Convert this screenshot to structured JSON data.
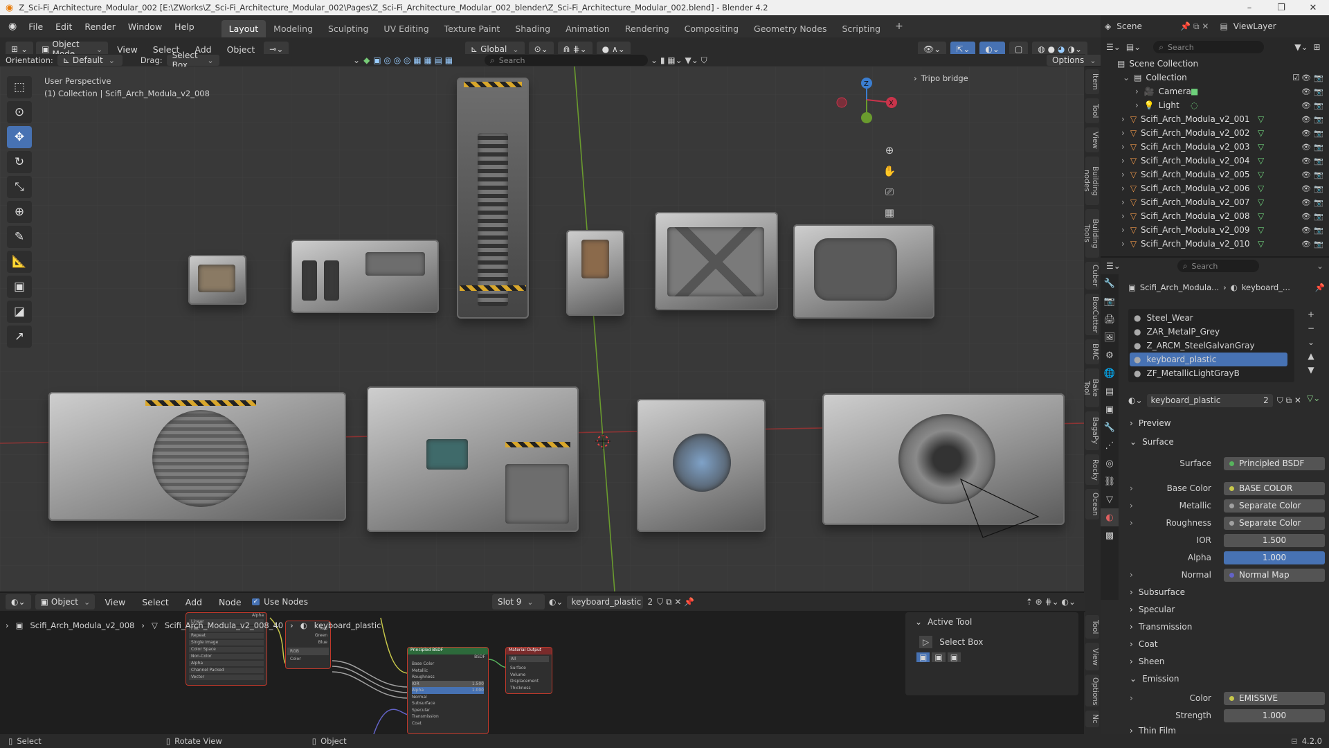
{
  "titlebar": {
    "title": "Z_Sci-Fi_Architecture_Modular_002 [E:\\ZWorks\\Z_Sci-Fi_Architecture_Modular_002\\Pages\\Z_Sci-Fi_Architecture_Modular_002_blender\\Z_Sci-Fi_Architecture_Modular_002.blend] - Blender 4.2",
    "minimize": "–",
    "maximize": "❐",
    "close": "✕"
  },
  "menu": [
    "File",
    "Edit",
    "Render",
    "Window",
    "Help"
  ],
  "workspaces": [
    {
      "label": "Layout",
      "active": true
    },
    {
      "label": "Modeling"
    },
    {
      "label": "Sculpting"
    },
    {
      "label": "UV Editing"
    },
    {
      "label": "Texture Paint"
    },
    {
      "label": "Shading"
    },
    {
      "label": "Animation"
    },
    {
      "label": "Rendering"
    },
    {
      "label": "Compositing"
    },
    {
      "label": "Geometry Nodes"
    },
    {
      "label": "Scripting"
    }
  ],
  "add_workspace": "+",
  "scene": {
    "label": "Scene",
    "viewlayer": "ViewLayer"
  },
  "viewport_header": {
    "mode": "Object Mode",
    "menus": [
      "View",
      "Select",
      "Add",
      "Object"
    ],
    "transform": "Global",
    "orientation_label": "Orientation:",
    "orientation": "Default",
    "drag_label": "Drag:",
    "drag": "Select Box",
    "search_placeholder": "Search",
    "options": "Options"
  },
  "viewport": {
    "perspective": "User Perspective",
    "collection_info": "(1) Collection | Scifi_Arch_Modula_v2_008",
    "tripo_bridge": "Tripo bridge",
    "gizmo": {
      "x": "X",
      "y": "Y",
      "z": "Z"
    }
  },
  "side_tabs": [
    "Item",
    "Tool",
    "View",
    "Building nodes",
    "Building Tools",
    "Cuber",
    "BoxCutter",
    "BMC",
    "Bake Tool",
    "BagaPy",
    "Rocky",
    "Ocean"
  ],
  "outliner": {
    "search_placeholder": "Search",
    "scene_collection": "Scene Collection",
    "collection": "Collection",
    "items": [
      {
        "name": "Camera",
        "type": "camera"
      },
      {
        "name": "Light",
        "type": "light"
      },
      {
        "name": "Scifi_Arch_Modula_v2_001",
        "type": "mesh"
      },
      {
        "name": "Scifi_Arch_Modula_v2_002",
        "type": "mesh"
      },
      {
        "name": "Scifi_Arch_Modula_v2_003",
        "type": "mesh"
      },
      {
        "name": "Scifi_Arch_Modula_v2_004",
        "type": "mesh"
      },
      {
        "name": "Scifi_Arch_Modula_v2_005",
        "type": "mesh"
      },
      {
        "name": "Scifi_Arch_Modula_v2_006",
        "type": "mesh"
      },
      {
        "name": "Scifi_Arch_Modula_v2_007",
        "type": "mesh"
      },
      {
        "name": "Scifi_Arch_Modula_v2_008",
        "type": "mesh",
        "selected": true
      },
      {
        "name": "Scifi_Arch_Modula_v2_009",
        "type": "mesh"
      },
      {
        "name": "Scifi_Arch_Modula_v2_010",
        "type": "mesh"
      }
    ]
  },
  "properties": {
    "search_placeholder": "Search",
    "breadcrumb_object": "Scifi_Arch_Modula...",
    "breadcrumb_material": "keyboard_...",
    "material_slots": [
      {
        "name": "Steel_Wear"
      },
      {
        "name": "ZAR_MetalP_Grey"
      },
      {
        "name": "Z_ARCM_SteelGalvanGray"
      },
      {
        "name": "keyboard_plastic",
        "active": true
      },
      {
        "name": "ZF_MetallicLightGrayB"
      }
    ],
    "material_name": "keyboard_plastic",
    "material_users": "2",
    "preview": "Preview",
    "surface_section": "Surface",
    "rows": [
      {
        "label": "Surface",
        "value": "Principled BSDF",
        "kind": "link",
        "color": "#57b35d"
      },
      {
        "label": "Base Color",
        "value": "BASE COLOR",
        "kind": "link",
        "color": "#c7c74a",
        "expand": true
      },
      {
        "label": "Metallic",
        "value": "Separate Color",
        "kind": "link",
        "color": "#a1a1a1",
        "expand": true
      },
      {
        "label": "Roughness",
        "value": "Separate Color",
        "kind": "link",
        "color": "#a1a1a1",
        "expand": true
      },
      {
        "label": "IOR",
        "value": "1.500",
        "kind": "num"
      },
      {
        "label": "Alpha",
        "value": "1.000",
        "kind": "blue"
      },
      {
        "label": "Normal",
        "value": "Normal Map",
        "kind": "link",
        "color": "#6363c7",
        "expand": true
      }
    ],
    "sections": [
      "Subsurface",
      "Specular",
      "Transmission",
      "Coat",
      "Sheen"
    ],
    "emission": "Emission",
    "emission_rows": [
      {
        "label": "Color",
        "value": "EMISSIVE",
        "kind": "link",
        "color": "#c7c74a",
        "expand": true
      },
      {
        "label": "Strength",
        "value": "1.000",
        "kind": "num"
      }
    ],
    "thin_film": "Thin Film"
  },
  "node_editor": {
    "type": "Object",
    "menus": [
      "View",
      "Select",
      "Add",
      "Node"
    ],
    "use_nodes": "Use Nodes",
    "slot": "Slot 9",
    "material": "keyboard_plastic",
    "users": "2",
    "breadcrumb": [
      "Scifi_Arch_Modula_v2_008",
      "Scifi_Arch_Modula_v2_008_40",
      "keyboard_plastic"
    ],
    "active_tool_title": "Active Tool",
    "active_tool_name": "Select Box",
    "side_tabs": [
      "Tool",
      "View",
      "Options",
      "Nc"
    ],
    "nodes": {
      "bsdf_title": "Principled BSDF",
      "bsdf_out": "BSDF",
      "bsdf_inputs": [
        "Base Color",
        "Metallic",
        "Roughness",
        "IOR",
        "Alpha",
        "Normal",
        "Subsurface",
        "Specular",
        "Transmission",
        "Coat"
      ],
      "bsdf_ior": "1.500",
      "bsdf_alpha": "1.000",
      "output_title": "Material Output",
      "output_target": "All",
      "output_inputs": [
        "Surface",
        "Volume",
        "Displacement",
        "Thickness"
      ],
      "tex_outputs": [
        "Alpha"
      ],
      "tex_rows": [
        "Linear",
        "Flat",
        "Repeat",
        "Single Image",
        "Color Space",
        "Non-Color",
        "Alpha",
        "Channel Packed",
        "Vector"
      ],
      "sep_outputs": [
        "Red",
        "Green",
        "Blue"
      ],
      "sep_mode": "RGB",
      "sep_input": "Color"
    }
  },
  "statusbar": {
    "select": "Select",
    "rotate": "Rotate View",
    "object": "Object",
    "version": "4.2.0"
  }
}
